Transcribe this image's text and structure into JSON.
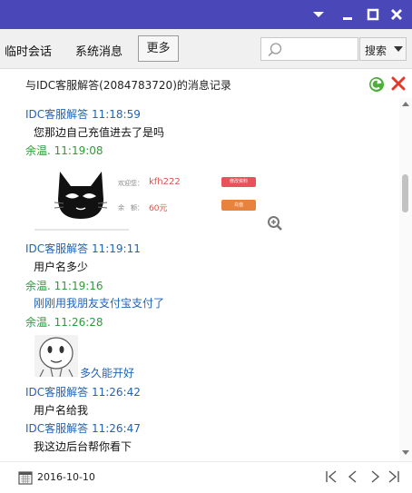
{
  "window": {
    "controls": [
      "chevron-down-icon",
      "minimize-icon",
      "maximize-icon",
      "close-icon"
    ]
  },
  "toolbar": {
    "tabs": [
      "临时会话",
      "系统消息"
    ],
    "more_label": "更多",
    "search_placeholder": "",
    "search_button_label": "搜索"
  },
  "history": {
    "title": "与IDC客服解答(2084783720)的消息记录"
  },
  "messages": [
    {
      "sender": "IDC客服解答 11:18:59",
      "text": "您那边自己充值进去了是吗"
    },
    {
      "sender": "余温. 11:19:08",
      "card": {
        "welcome_label": "欢迎您：",
        "username": "kfh222",
        "balance_label": "余　额：",
        "balance": "60元",
        "edit_btn": "修改资料",
        "recharge_btn": "充值"
      }
    },
    {
      "sender": "IDC客服解答 11:19:11",
      "text": "用户名多少"
    },
    {
      "sender": "余温. 11:19:16",
      "text": "刚刚用我朋友支付宝支付了"
    },
    {
      "sender": "余温. 11:26:28",
      "text": "多久能开好"
    },
    {
      "sender": "IDC客服解答 11:26:42",
      "text": "用户名给我"
    },
    {
      "sender": "IDC客服解答 11:26:47",
      "text": "我这边后台帮你看下"
    }
  ],
  "footer": {
    "date": "2016-10-10"
  },
  "colors": {
    "titlebar": "#4a47b8",
    "service_name": "#1f63b8",
    "user_name": "#2e9b3a",
    "price": "#e0504a"
  }
}
